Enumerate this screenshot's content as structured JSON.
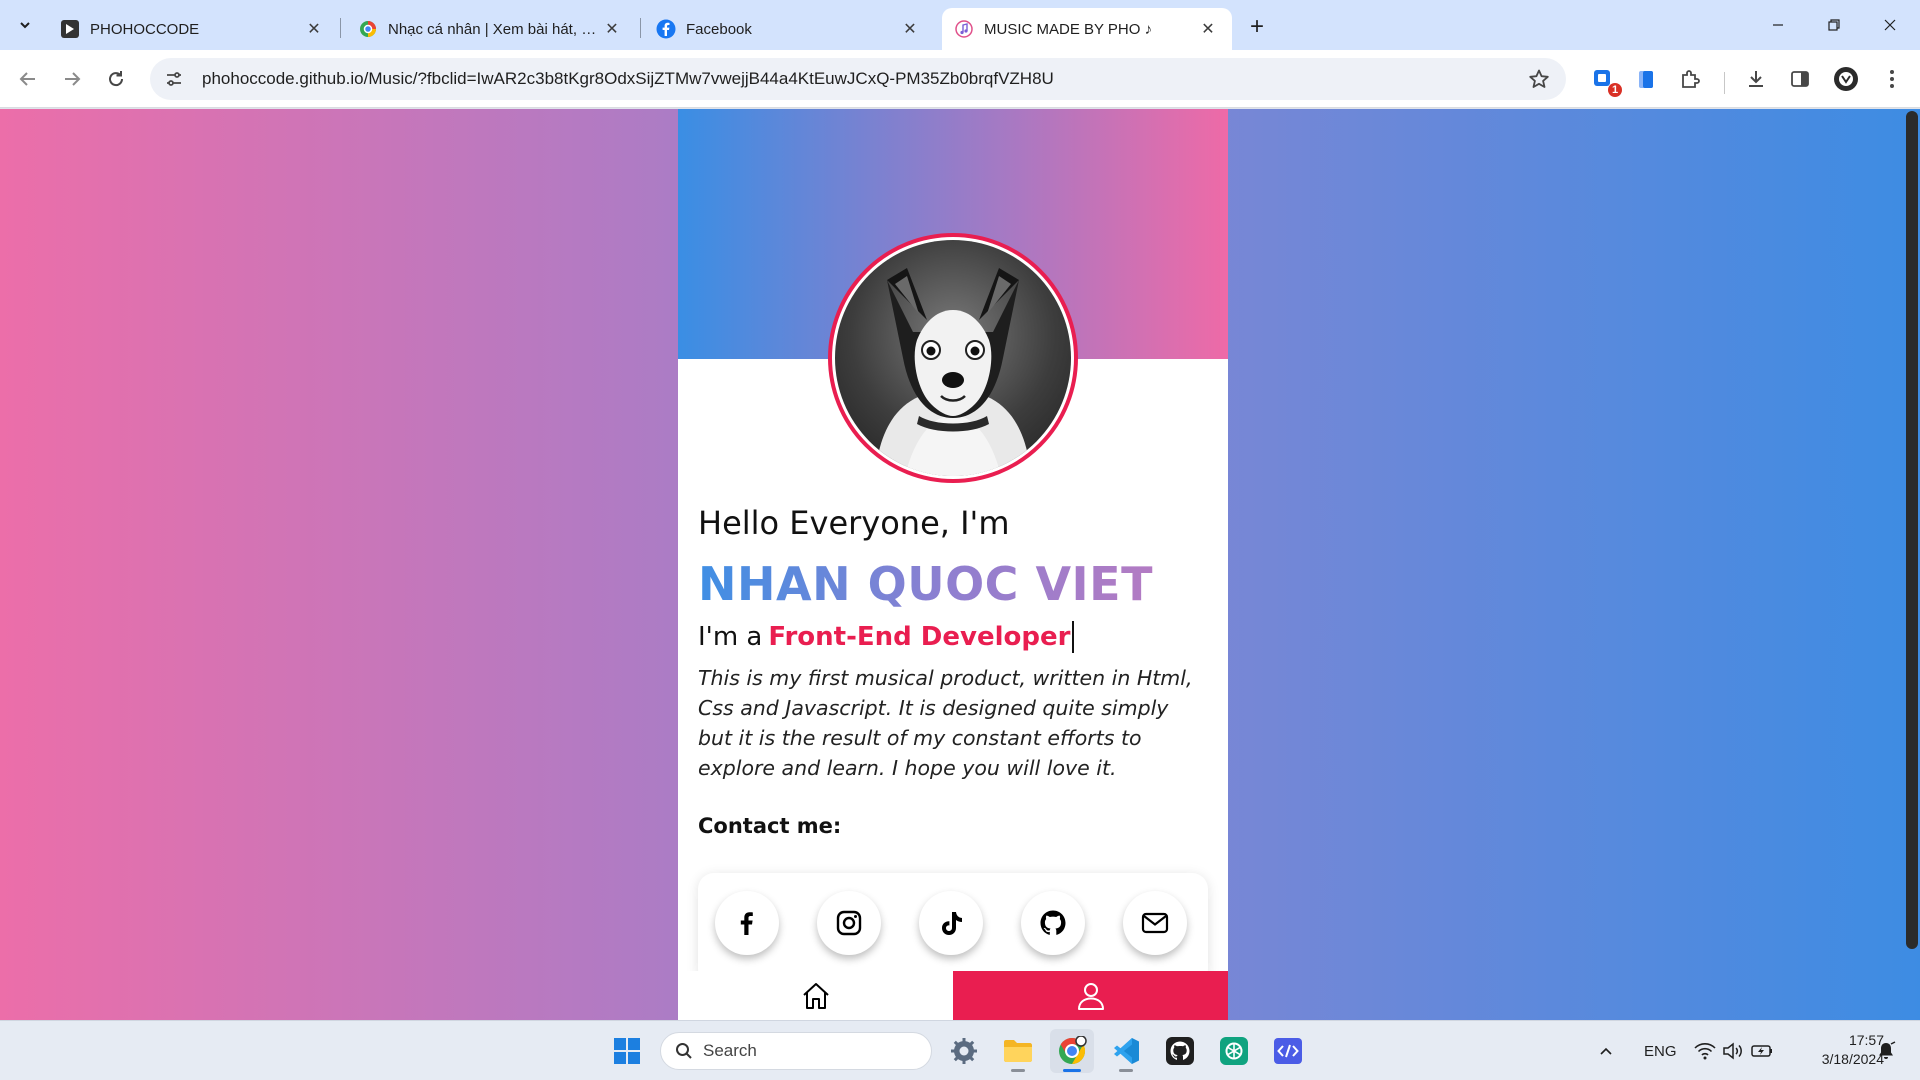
{
  "browser": {
    "tabs": [
      {
        "title": "PHOHOCCODE",
        "favicon": "phohoccode-logo-icon",
        "active": false
      },
      {
        "title": "Nhạc cá nhân | Xem bài hát, album",
        "favicon": "zing-music-icon",
        "active": false
      },
      {
        "title": "Facebook",
        "favicon": "facebook-icon",
        "active": false
      },
      {
        "title": "MUSIC MADE BY PHO ♪",
        "favicon": "music-note-icon",
        "active": true
      }
    ],
    "url": "phohoccode.github.io/Music/?fbclid=IwAR2c3b8tKgr8OdxSijZTMw7vwejjB44a4KtEuwJCxQ-PM35Zb0brqfVZH8U",
    "extension_badge": "1"
  },
  "profile": {
    "greeting": "Hello Everyone, I'm",
    "name": "NHAN QUOC VIET",
    "role_prefix": "I'm a",
    "role": "Front-End Developer",
    "intro": "This is my first musical product, written in Html, Css and Javascript. It is designed quite simply but it is the result of my constant efforts to explore and learn. I hope you will love it.",
    "contact_label": "Contact me:",
    "socials": [
      "facebook-icon",
      "instagram-icon",
      "tiktok-icon",
      "github-icon",
      "email-icon"
    ],
    "accent_color": "#e91e50"
  },
  "bottom_nav": [
    {
      "name": "home",
      "icon": "home-icon",
      "active": false
    },
    {
      "name": "profile",
      "icon": "user-icon",
      "active": true
    }
  ],
  "taskbar": {
    "search_placeholder": "Search",
    "language": "ENG",
    "time": "17:57",
    "date": "3/18/2024"
  }
}
